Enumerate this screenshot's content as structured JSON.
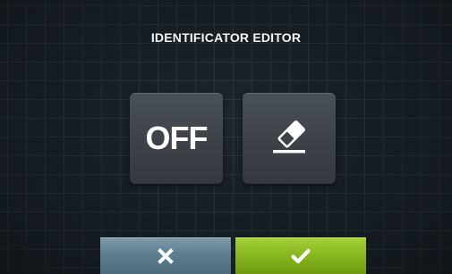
{
  "header": {
    "title": "IDENTIFICATOR EDITOR"
  },
  "tiles": {
    "off_label": "OFF",
    "edit_icon": "eraser-icon"
  },
  "footer": {
    "cancel_icon": "close-icon",
    "confirm_icon": "checkmark-icon"
  },
  "colors": {
    "background": "#141b21",
    "tile": "#3c4248",
    "cancel": "#5f7f91",
    "confirm": "#86b51d",
    "text": "#ffffff"
  }
}
